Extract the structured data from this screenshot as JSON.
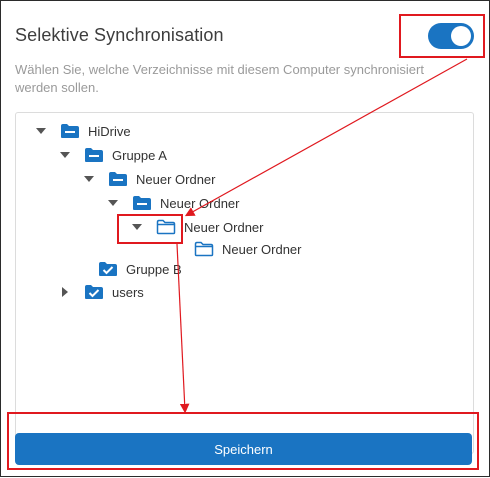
{
  "header": {
    "title": "Selektive Synchronisation",
    "description": "Wählen Sie, welche Verzeichnisse mit diesem Computer synchronisiert werden sollen."
  },
  "toggle": {
    "state": "on"
  },
  "tree": {
    "items": [
      {
        "label": "HiDrive",
        "state": "partial",
        "expanded": true
      },
      {
        "label": "Gruppe A",
        "state": "partial",
        "expanded": true
      },
      {
        "label": "Neuer Ordner",
        "state": "partial",
        "expanded": true
      },
      {
        "label": "Neuer Ordner",
        "state": "partial",
        "expanded": true
      },
      {
        "label": "Neuer Ordner",
        "state": "unchecked",
        "expanded": true
      },
      {
        "label": "Neuer Ordner",
        "state": "unchecked",
        "expanded": false
      },
      {
        "label": "Gruppe B",
        "state": "checked",
        "expanded": false
      },
      {
        "label": "users",
        "state": "checked",
        "expanded": false
      }
    ]
  },
  "footer": {
    "save_label": "Speichern"
  },
  "colors": {
    "accent": "#1a74c2",
    "highlight": "#e0191f"
  }
}
